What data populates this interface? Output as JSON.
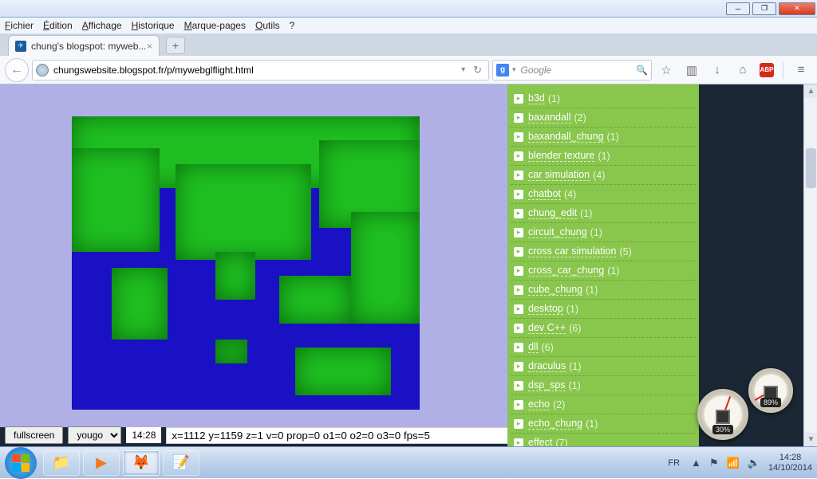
{
  "window": {
    "min_tip": "Minimize",
    "max_tip": "Restore",
    "close_tip": "Close"
  },
  "menus": {
    "file": "Fichier",
    "edit": "Édition",
    "view": "Affichage",
    "history": "Historique",
    "bookmarks": "Marque-pages",
    "tools": "Outils",
    "help": "?"
  },
  "tab": {
    "title": "chung's blogspot: myweb...",
    "close": "×",
    "new": "+"
  },
  "nav": {
    "back_glyph": "←",
    "url": "chungswebsite.blogspot.fr/p/mywebglflight.html",
    "reload_glyph": "↻",
    "search_placeholder": "Google",
    "engine_letter": "g",
    "magnify": "🔍",
    "star": "☆",
    "reader": "▥",
    "download": "↓",
    "home": "⌂",
    "abp": "ABP",
    "menu_glyph": "≡"
  },
  "controls": {
    "fullscreen": "fullscreen",
    "location": "yougo",
    "time": "14:28",
    "status": "x=1112 y=1159 z=1 v=0 prop=0 o1=0 o2=0 o3=0 fps=5"
  },
  "sidebar": [
    {
      "label": "b3d",
      "count": "(1)"
    },
    {
      "label": "baxandall",
      "count": "(2)"
    },
    {
      "label": "baxandall_chung",
      "count": "(1)"
    },
    {
      "label": "blender texture",
      "count": "(1)"
    },
    {
      "label": "car simulation",
      "count": "(4)"
    },
    {
      "label": "chatbot",
      "count": "(4)"
    },
    {
      "label": "chung_edit",
      "count": "(1)"
    },
    {
      "label": "circuit_chung",
      "count": "(1)"
    },
    {
      "label": "cross car simulation",
      "count": "(5)"
    },
    {
      "label": "cross_car_chung",
      "count": "(1)"
    },
    {
      "label": "cube_chung",
      "count": "(1)"
    },
    {
      "label": "desktop",
      "count": "(1)"
    },
    {
      "label": "dev C++",
      "count": "(6)"
    },
    {
      "label": "dll",
      "count": "(6)"
    },
    {
      "label": "draculus",
      "count": "(1)"
    },
    {
      "label": "dsp_sps",
      "count": "(1)"
    },
    {
      "label": "echo",
      "count": "(2)"
    },
    {
      "label": "echo_chung",
      "count": "(1)"
    },
    {
      "label": "effect",
      "count": "(7)"
    }
  ],
  "gadget": {
    "cpu_pct": "30%",
    "ram_pct": "89%"
  },
  "systray": {
    "lang": "FR",
    "flag": "▲",
    "net": "📶",
    "vol": "🔈",
    "time": "14:28",
    "date": "14/10/2014"
  }
}
